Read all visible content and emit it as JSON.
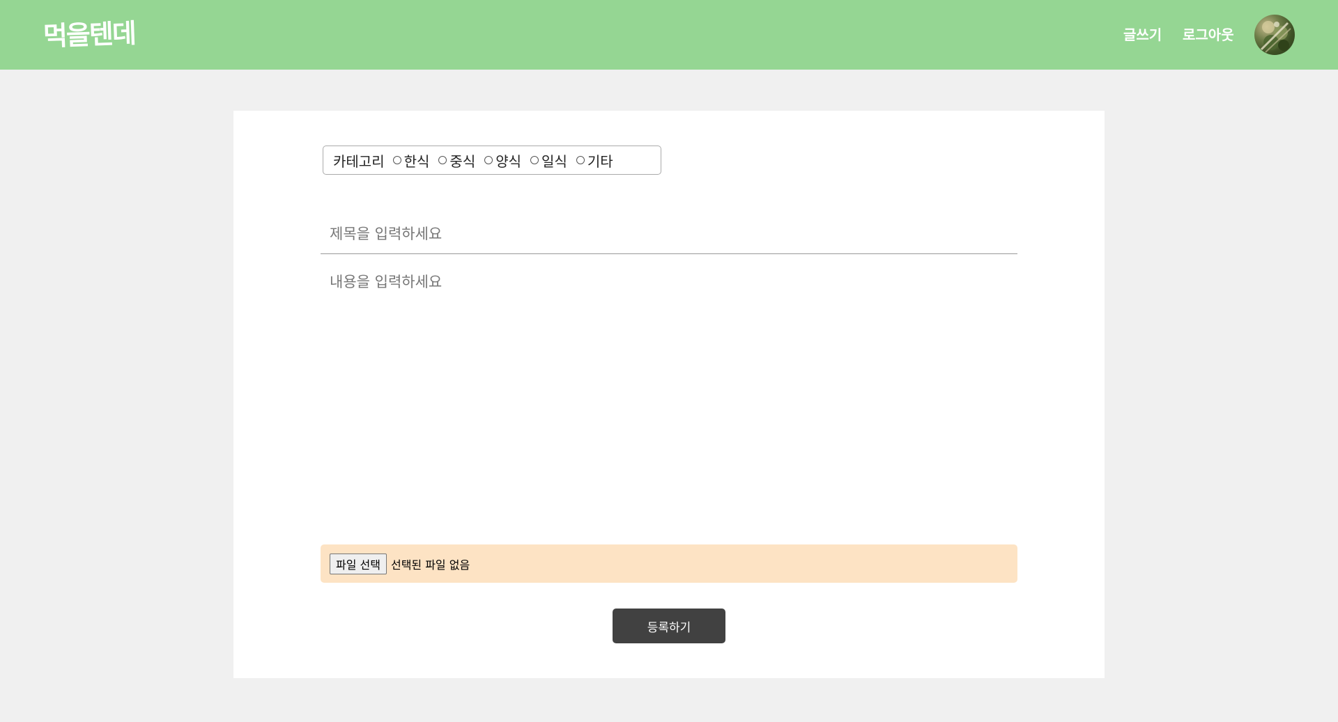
{
  "header": {
    "logo": "먹을텐데",
    "nav": {
      "write": "글쓰기",
      "logout": "로그아웃"
    }
  },
  "form": {
    "category": {
      "label": "카테고리",
      "options": [
        "한식",
        "중식",
        "양식",
        "일식",
        "기타"
      ],
      "selected": null
    },
    "title": {
      "placeholder": "제목을 입력하세요",
      "value": ""
    },
    "content": {
      "placeholder": "내용을 입력하세요",
      "value": ""
    },
    "file": {
      "button_label": "파일 선택",
      "status": "선택된 파일 없음"
    },
    "submit_label": "등록하기"
  },
  "colors": {
    "header_bg": "#95d693",
    "page_bg": "#f0f0f0",
    "file_area_bg": "#fde3c4",
    "submit_bg": "#414141"
  }
}
